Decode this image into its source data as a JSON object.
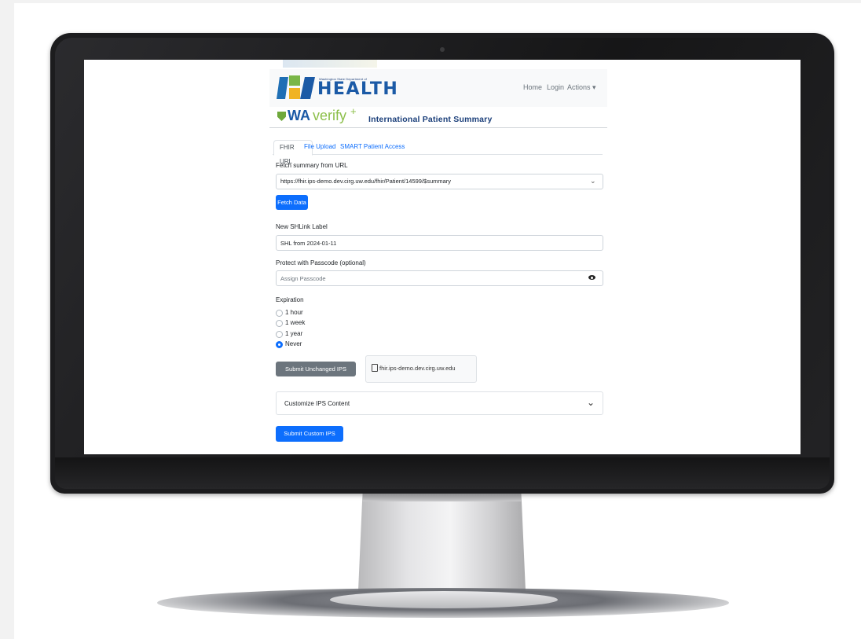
{
  "header": {
    "agency_line": "Washington State Department of",
    "logo_word": "HEALTH",
    "nav": {
      "home": "Home",
      "login": "Login",
      "actions": "Actions ▾"
    }
  },
  "brand": {
    "wa": "WA",
    "verify": "verify",
    "plus": "+",
    "title": "International Patient Summary"
  },
  "tabs": [
    "FHIR URL",
    "File Upload",
    "SMART Patient Access"
  ],
  "fetch": {
    "label": "Fetch summary from URL",
    "url": "https://fhir.ips-demo.dev.cirg.uw.edu/fhir/Patient/14599/$summary",
    "button": "Fetch Data"
  },
  "shlink": {
    "label": "New SHLink Label",
    "value": "SHL from 2024-01-11"
  },
  "passcode": {
    "label": "Protect with Passcode (optional)",
    "placeholder": "Assign Passcode"
  },
  "expiration": {
    "label": "Expiration",
    "options": [
      "1 hour",
      "1 week",
      "1 year",
      "Never"
    ],
    "selected": "Never"
  },
  "submit_unchanged": "Submit Unchanged IPS",
  "source_host": "fhir.ips-demo.dev.cirg.uw.edu",
  "customize": "Customize IPS Content",
  "submit_custom": "Submit Custom IPS",
  "colors": {
    "primary": "#0d6efd",
    "secondary": "#6c757d",
    "health_blue": "#1b5aa6",
    "verify_green": "#8cbf4a"
  }
}
